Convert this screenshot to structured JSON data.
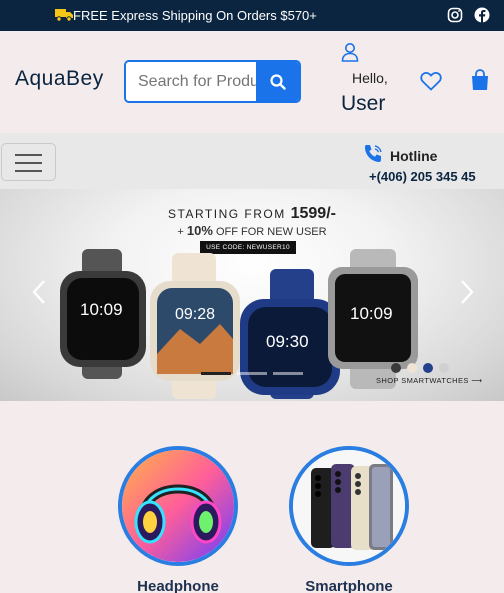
{
  "topbar": {
    "promo": "FREE Express Shipping On Orders $570+",
    "icons": [
      "truck-icon",
      "instagram-icon",
      "facebook-icon"
    ]
  },
  "header": {
    "logo": "AquaBey",
    "search_placeholder": "Search for Products",
    "hello": "Hello,",
    "user": "User"
  },
  "nav": {
    "hotline_label": "Hotline",
    "hotline_number": "+(406) 205 345 45"
  },
  "banner": {
    "starting_prefix": "STARTING FROM",
    "price": "1599/-",
    "offer_prefix": "+",
    "offer_percent": "10%",
    "offer_suffix": "OFF FOR NEW USER",
    "code": "USE CODE: NEWUSER10",
    "shop": "SHOP SMARTWATCHES",
    "watch_times": [
      "10:09",
      "09:28",
      "09:30",
      "10:09"
    ],
    "slides": 3,
    "active_slide": 1
  },
  "categories": [
    {
      "label": "Headphone"
    },
    {
      "label": "Smartphone"
    }
  ],
  "colors": {
    "topbar": "#0b2540",
    "accent": "#1a73e8",
    "background": "#f4ecec",
    "nav": "#e8e8e8"
  }
}
